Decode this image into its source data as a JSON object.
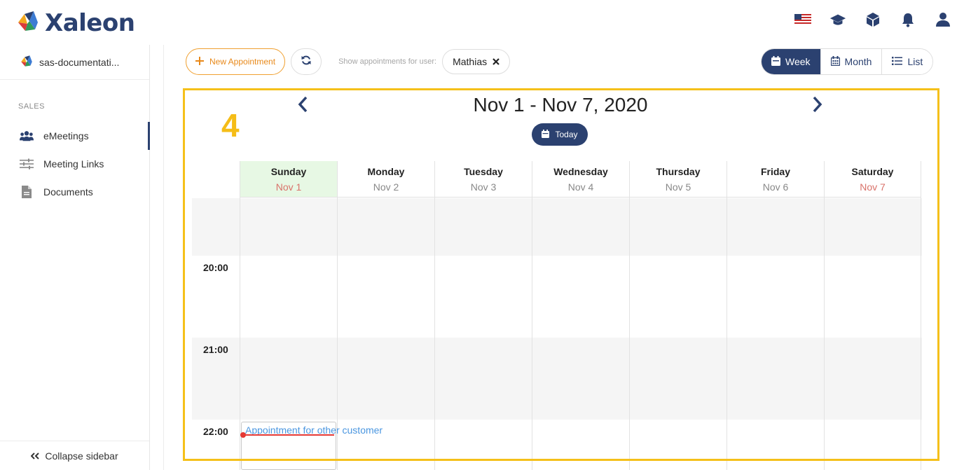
{
  "app": {
    "name": "Xaleon",
    "icons": [
      "us-flag-icon",
      "graduation-cap-icon",
      "cube-icon",
      "bell-icon",
      "user-icon"
    ]
  },
  "sidebar": {
    "org_name": "sas-documentati...",
    "section": "SALES",
    "items": [
      {
        "label": "eMeetings",
        "icon": "users-icon",
        "active": true
      },
      {
        "label": "Meeting Links",
        "icon": "sliders-icon",
        "active": false
      },
      {
        "label": "Documents",
        "icon": "document-icon",
        "active": false
      }
    ],
    "collapse_label": "Collapse sidebar"
  },
  "toolbar": {
    "new_label": "New Appointment",
    "show_label": "Show appointments for user:",
    "user": "Mathias"
  },
  "views": {
    "week": "Week",
    "month": "Month",
    "list": "List",
    "active": "week"
  },
  "calendar": {
    "step": "4",
    "range": "Nov 1 - Nov 7, 2020",
    "today_label": "Today",
    "days": [
      {
        "name": "Sunday",
        "date": "Nov 1"
      },
      {
        "name": "Monday",
        "date": "Nov 2"
      },
      {
        "name": "Tuesday",
        "date": "Nov 3"
      },
      {
        "name": "Wednesday",
        "date": "Nov 4"
      },
      {
        "name": "Thursday",
        "date": "Nov 5"
      },
      {
        "name": "Friday",
        "date": "Nov 6"
      },
      {
        "name": "Saturday",
        "date": "Nov 7"
      }
    ],
    "times": [
      "20:00",
      "21:00",
      "22:00"
    ],
    "appointment": "Appointment for other customer"
  },
  "colors": {
    "brand": "#2b4170",
    "accent": "#f0a030",
    "highlight": "#f5c01a",
    "today_bg": "#e7f8e4",
    "now_line": "#e53935",
    "appointment_text": "#4a96e0"
  }
}
